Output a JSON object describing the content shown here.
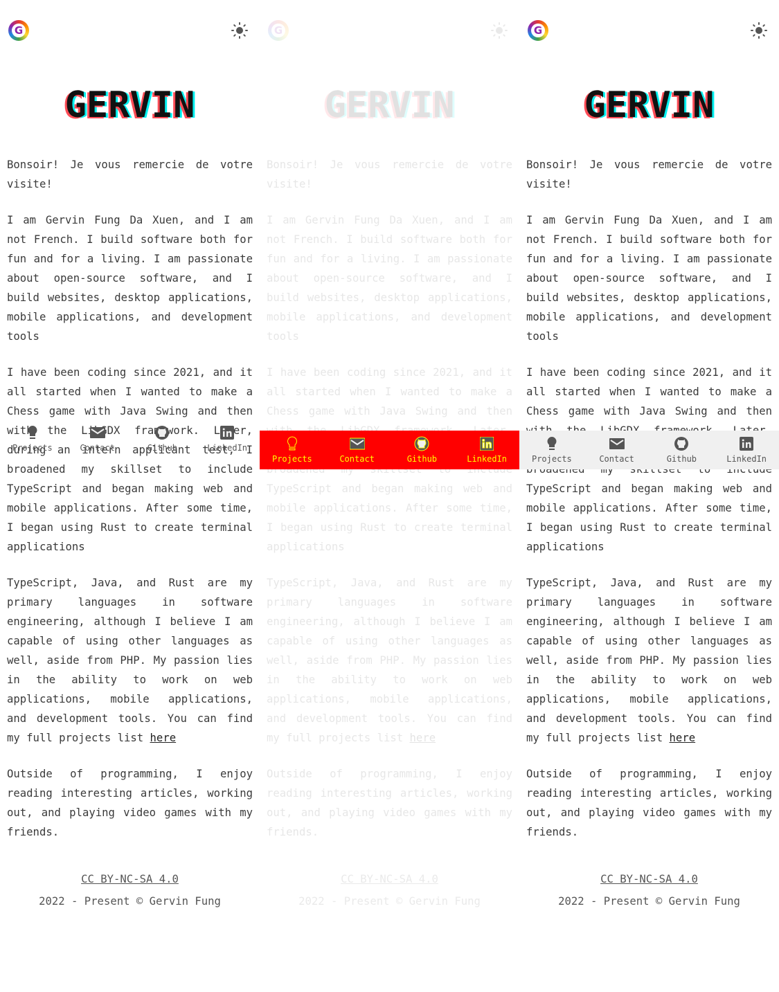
{
  "header": {
    "logo_letter": "G",
    "theme_toggle": "sun-icon"
  },
  "title": "GERVIN",
  "paragraphs": [
    "Bonsoir! Je vous remercie de votre visite!",
    "I am Gervin Fung Da Xuen, and I am not French. I build software both for fun and for a living. I am passionate about open-source software, and I build websites, desktop applications, mobile applications, and development tools",
    "I have been coding since 2021, and it all started when I wanted to make a Chess game with Java Swing and then with the LibGDX framework. Later, during an intern applicant test, I broadened my skillset to include TypeScript and began making web and mobile applications. After some time, I began using Rust to create terminal applications",
    "TypeScript, Java, and Rust are my primary languages in software engineering, although I believe I am capable of using other languages as well, aside from PHP. My passion lies in the ability to work on web applications, mobile applications, and development tools. You can find my full projects list ",
    "Outside of programming, I enjoy reading interesting articles, working out, and playing video games with my friends."
  ],
  "projects_link": "here",
  "footer": {
    "license": "CC BY-NC-SA 4.0",
    "copyright": "2022 - Present © Gervin Fung"
  },
  "nav": [
    {
      "label": "Projects",
      "icon": "lightbulb-icon"
    },
    {
      "label": "Contact",
      "icon": "mail-icon"
    },
    {
      "label": "Github",
      "icon": "github-icon"
    },
    {
      "label": "LinkedIn",
      "icon": "linkedin-icon"
    }
  ],
  "colors": {
    "diff_band": "#ff0000",
    "diff_text": "#ffff00",
    "nav_bg": "#f0f0f0"
  }
}
